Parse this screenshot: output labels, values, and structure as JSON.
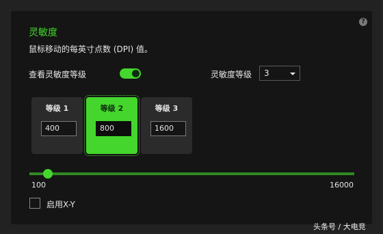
{
  "header": {
    "title": "灵敏度",
    "description": "鼠标移动的每英寸点数 (DPI) 值。",
    "help_icon": "?"
  },
  "sensitivity_stages": {
    "label": "查看灵敏度等级",
    "enabled": true,
    "count_label": "灵敏度等级",
    "count_value": "3"
  },
  "stages": [
    {
      "label": "等级 1",
      "value": "400"
    },
    {
      "label": "等级 2",
      "value": "800"
    },
    {
      "label": "等级 3",
      "value": "1600"
    }
  ],
  "active_stage_index": 1,
  "slider": {
    "min": "100",
    "max": "16000",
    "value": 800
  },
  "xy": {
    "label": "启用X-Y",
    "checked": false
  },
  "watermark": "头条号 / 大电竞",
  "colors": {
    "accent": "#44d62c",
    "panel": "#151515",
    "background": "#222222"
  }
}
